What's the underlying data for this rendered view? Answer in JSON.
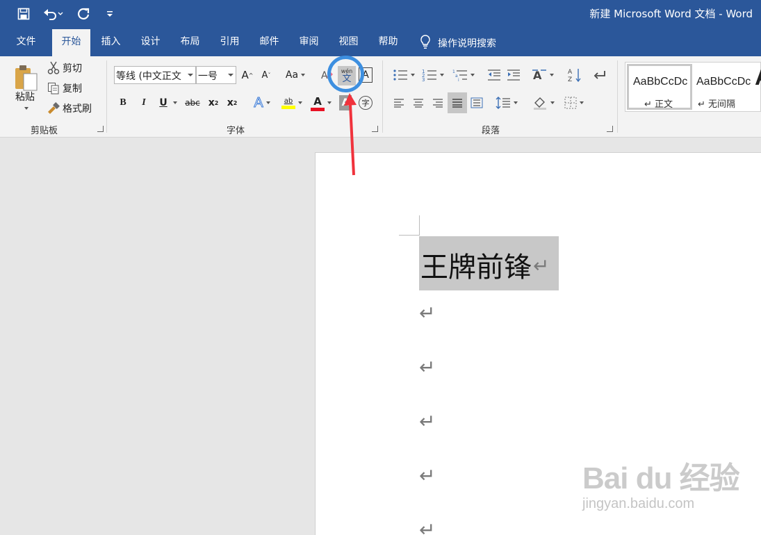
{
  "window": {
    "title": "新建 Microsoft Word 文档  -  Word"
  },
  "quick_access": {
    "items": [
      "save-icon",
      "undo-icon",
      "redo-icon",
      "customize-icon"
    ]
  },
  "tabs": [
    {
      "label": "文件"
    },
    {
      "label": "开始"
    },
    {
      "label": "插入"
    },
    {
      "label": "设计"
    },
    {
      "label": "布局"
    },
    {
      "label": "引用"
    },
    {
      "label": "邮件"
    },
    {
      "label": "审阅"
    },
    {
      "label": "视图"
    },
    {
      "label": "帮助"
    }
  ],
  "active_tab": "开始",
  "tell_me": {
    "label": "操作说明搜索"
  },
  "clipboard": {
    "paste_label": "粘贴",
    "cut_label": "剪切",
    "copy_label": "复制",
    "format_painter_label": "格式刷",
    "group_label": "剪贴板"
  },
  "font": {
    "font_name": "等线 (中文正文",
    "font_size": "一号",
    "grow": "A",
    "shrink": "A",
    "change_case": "Aa",
    "bold": "B",
    "italic": "I",
    "underline": "U",
    "strikethrough": "abc",
    "subscript": "x",
    "superscript": "x",
    "subsuper_2": "2",
    "highlight_top": "ab",
    "font_color": "A",
    "char_shading": "A",
    "phonetic_top": "wén",
    "phonetic_bottom": "文",
    "char_border": "A",
    "enclose": "字",
    "group_label": "字体"
  },
  "paragraph": {
    "group_label": "段落"
  },
  "styles": {
    "items": [
      {
        "sample": "AaBbCcDc",
        "name": "↵ 正文"
      },
      {
        "sample": "AaBbCcDc",
        "name": "↵ 无间隔"
      }
    ]
  },
  "document": {
    "selected_text": "王牌前锋",
    "paragraph_mark": "↵"
  },
  "colors": {
    "brand": "#2b579a",
    "highlight_yellow": "#ffff00",
    "font_red": "#e81123",
    "annotation_blue": "#3d8fe0",
    "annotation_red": "#f0323c"
  },
  "watermark": {
    "logo": "Bai du 经验",
    "url": "jingyan.baidu.com"
  }
}
